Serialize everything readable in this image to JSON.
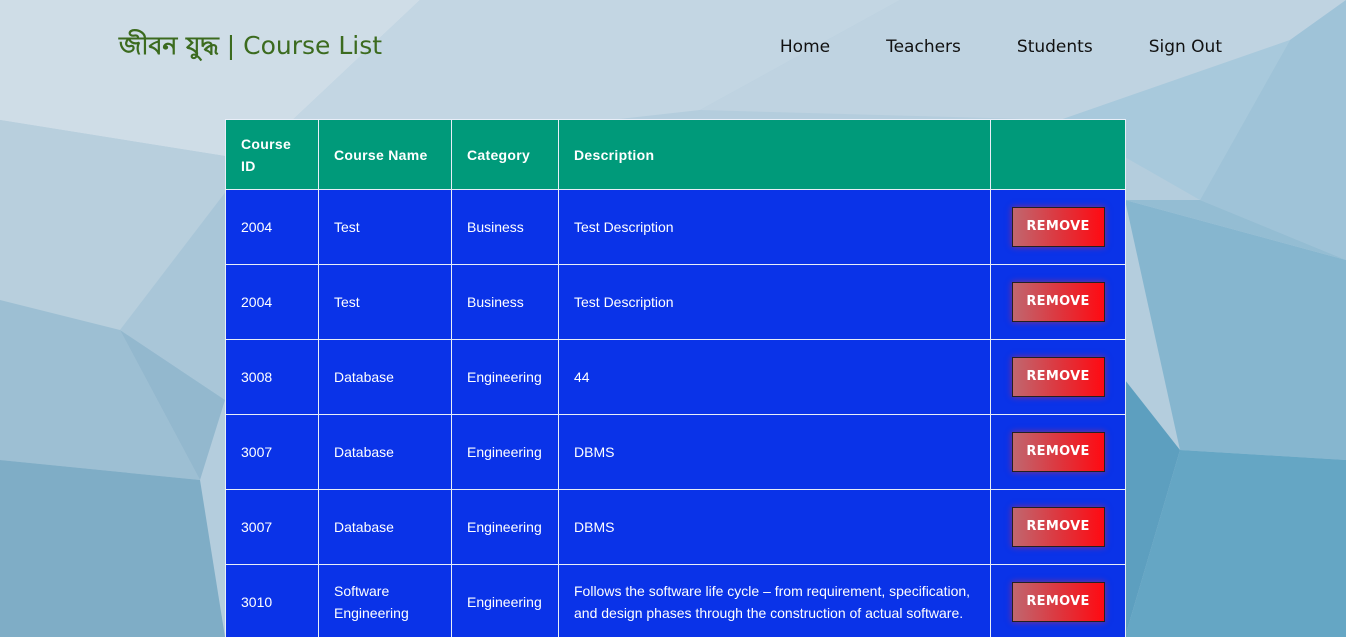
{
  "header": {
    "brand_bengali": "জীবন যুদ্ধ",
    "brand_separator": " | ",
    "brand_title": "Course List"
  },
  "nav": {
    "items": [
      {
        "label": "Home"
      },
      {
        "label": "Teachers"
      },
      {
        "label": "Students"
      },
      {
        "label": "Sign Out"
      }
    ]
  },
  "table": {
    "columns": [
      "Course ID",
      "Course Name",
      "Category",
      "Description",
      ""
    ],
    "rows": [
      {
        "id": "2004",
        "name": "Test",
        "category": "Business",
        "description": "Test Description",
        "action": "REMOVE"
      },
      {
        "id": "2004",
        "name": "Test",
        "category": "Business",
        "description": "Test Description",
        "action": "REMOVE"
      },
      {
        "id": "3008",
        "name": "Database",
        "category": "Engineering",
        "description": "44",
        "action": "REMOVE"
      },
      {
        "id": "3007",
        "name": "Database",
        "category": "Engineering",
        "description": "DBMS",
        "action": "REMOVE"
      },
      {
        "id": "3007",
        "name": "Database",
        "category": "Engineering",
        "description": "DBMS",
        "action": "REMOVE"
      },
      {
        "id": "3010",
        "name": "Software Engineering",
        "category": "Engineering",
        "description": "Follows the software life cycle – from requirement, specification, and design phases through the construction of actual software.",
        "action": "REMOVE"
      }
    ]
  },
  "colors": {
    "header_bg": "#009a7a",
    "row_bg": "#0a33e8",
    "brand": "#3c6b1f",
    "remove_button": "#ff0a12"
  }
}
